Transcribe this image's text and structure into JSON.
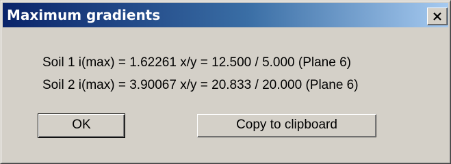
{
  "window": {
    "title": "Maximum gradients"
  },
  "results": [
    "Soil 1 i(max) = 1.62261 x/y = 12.500 / 5.000 (Plane 6)",
    "Soil 2 i(max) = 3.90067 x/y = 20.833 / 20.000 (Plane 6)"
  ],
  "buttons": {
    "ok_label": "OK",
    "copy_label": "Copy to clipboard"
  },
  "icons": {
    "close": "close-icon"
  },
  "colors": {
    "titlebar_start": "#0a246a",
    "titlebar_end": "#a6caf0",
    "dialog_face": "#d4d0c8"
  }
}
